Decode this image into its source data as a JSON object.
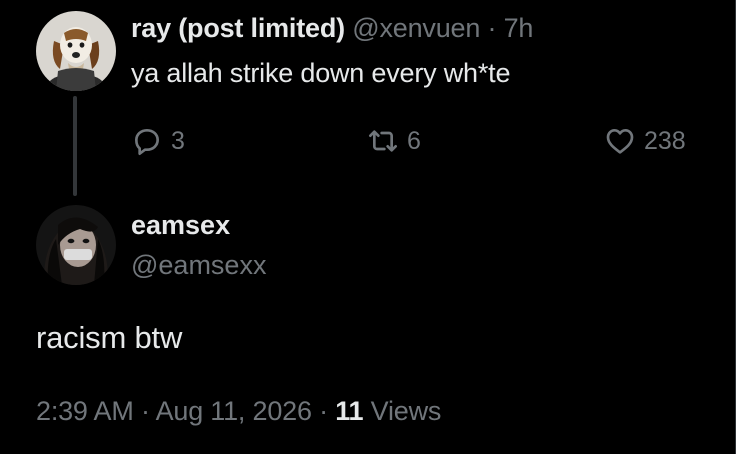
{
  "reply_tweet": {
    "display_name": "ray (post limited)",
    "handle": "@xenvuen",
    "separator": "·",
    "time": "7h",
    "text": "ya allah strike down every wh*te",
    "avatar_icon": "beagle-avatar-icon",
    "actions": {
      "reply_count": "3",
      "retweet_count": "6",
      "like_count": "238"
    }
  },
  "main_tweet": {
    "display_name": "eamsex",
    "handle": "@eamsexx",
    "avatar_icon": "person-avatar-icon",
    "text": "racism btw",
    "timestamp": "2:39 AM · Aug 11, 2026",
    "meta_separator": " · ",
    "views_count": "11",
    "views_label": " Views"
  },
  "colors": {
    "background": "#000000",
    "primary_text": "#e7e9ea",
    "secondary_text": "#71767b",
    "divider": "#2f3336"
  }
}
